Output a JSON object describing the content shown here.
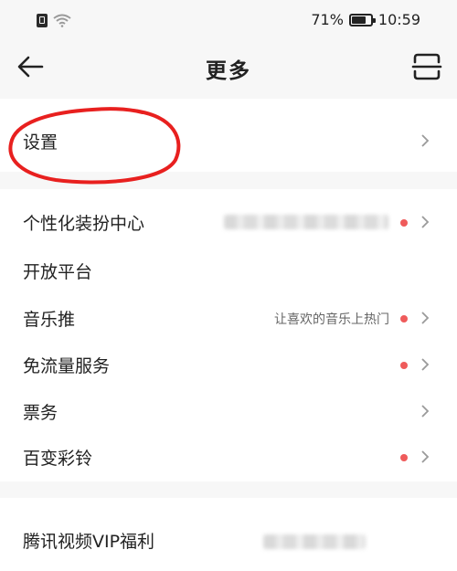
{
  "status_bar": {
    "battery_percent": "71%",
    "time": "10:59"
  },
  "nav": {
    "title": "更多"
  },
  "menu": {
    "settings": {
      "label": "设置"
    },
    "items": [
      {
        "label": "个性化装扮中心",
        "has_dot": true
      },
      {
        "label": "开放平台",
        "has_dot": false
      },
      {
        "label": "音乐推",
        "hint": "让喜欢的音乐上热门",
        "has_dot": true
      },
      {
        "label": "免流量服务",
        "has_dot": true
      },
      {
        "label": "票务",
        "has_dot": false
      },
      {
        "label": "百变彩铃",
        "has_dot": true
      }
    ],
    "bottom": {
      "label": "腾讯视频VIP福利"
    }
  },
  "colors": {
    "dot": "#ef5b5b",
    "annotation": "#e8201f",
    "background": "#f7f7f7"
  }
}
